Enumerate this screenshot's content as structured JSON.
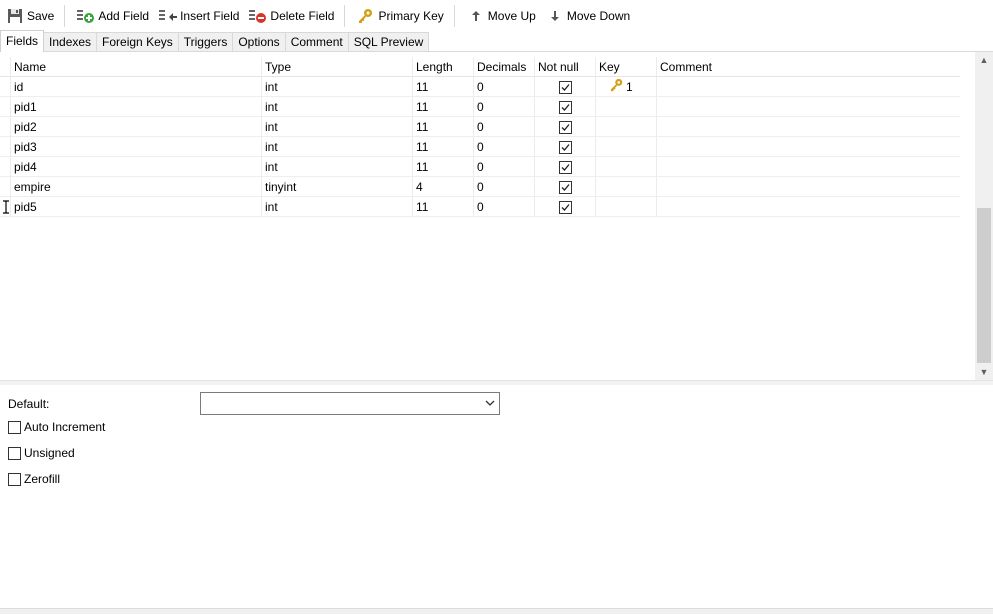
{
  "toolbar": {
    "save": "Save",
    "add_field": "Add Field",
    "insert_field": "Insert Field",
    "delete_field": "Delete Field",
    "primary_key": "Primary Key",
    "move_up": "Move Up",
    "move_down": "Move Down"
  },
  "tabs": [
    "Fields",
    "Indexes",
    "Foreign Keys",
    "Triggers",
    "Options",
    "Comment",
    "SQL Preview"
  ],
  "active_tab": "Fields",
  "columns": [
    "Name",
    "Type",
    "Length",
    "Decimals",
    "Not null",
    "Key",
    "Comment"
  ],
  "rows": [
    {
      "name": "id",
      "type": "int",
      "length": "11",
      "decimals": "0",
      "not_null": true,
      "key": "1",
      "comment": ""
    },
    {
      "name": "pid1",
      "type": "int",
      "length": "11",
      "decimals": "0",
      "not_null": true,
      "key": "",
      "comment": ""
    },
    {
      "name": "pid2",
      "type": "int",
      "length": "11",
      "decimals": "0",
      "not_null": true,
      "key": "",
      "comment": ""
    },
    {
      "name": "pid3",
      "type": "int",
      "length": "11",
      "decimals": "0",
      "not_null": true,
      "key": "",
      "comment": ""
    },
    {
      "name": "pid4",
      "type": "int",
      "length": "11",
      "decimals": "0",
      "not_null": true,
      "key": "",
      "comment": ""
    },
    {
      "name": "empire",
      "type": "tinyint",
      "length": "4",
      "decimals": "0",
      "not_null": true,
      "key": "",
      "comment": ""
    },
    {
      "name": "pid5",
      "type": "int",
      "length": "11",
      "decimals": "0",
      "not_null": true,
      "key": "",
      "comment": ""
    }
  ],
  "properties": {
    "default_label": "Default:",
    "default_value": "",
    "auto_increment": "Auto Increment",
    "unsigned": "Unsigned",
    "zerofill": "Zerofill"
  },
  "colors": {
    "key_gold": "#d4a017",
    "add_green": "#3aa33a",
    "delete_red": "#d9342b"
  }
}
